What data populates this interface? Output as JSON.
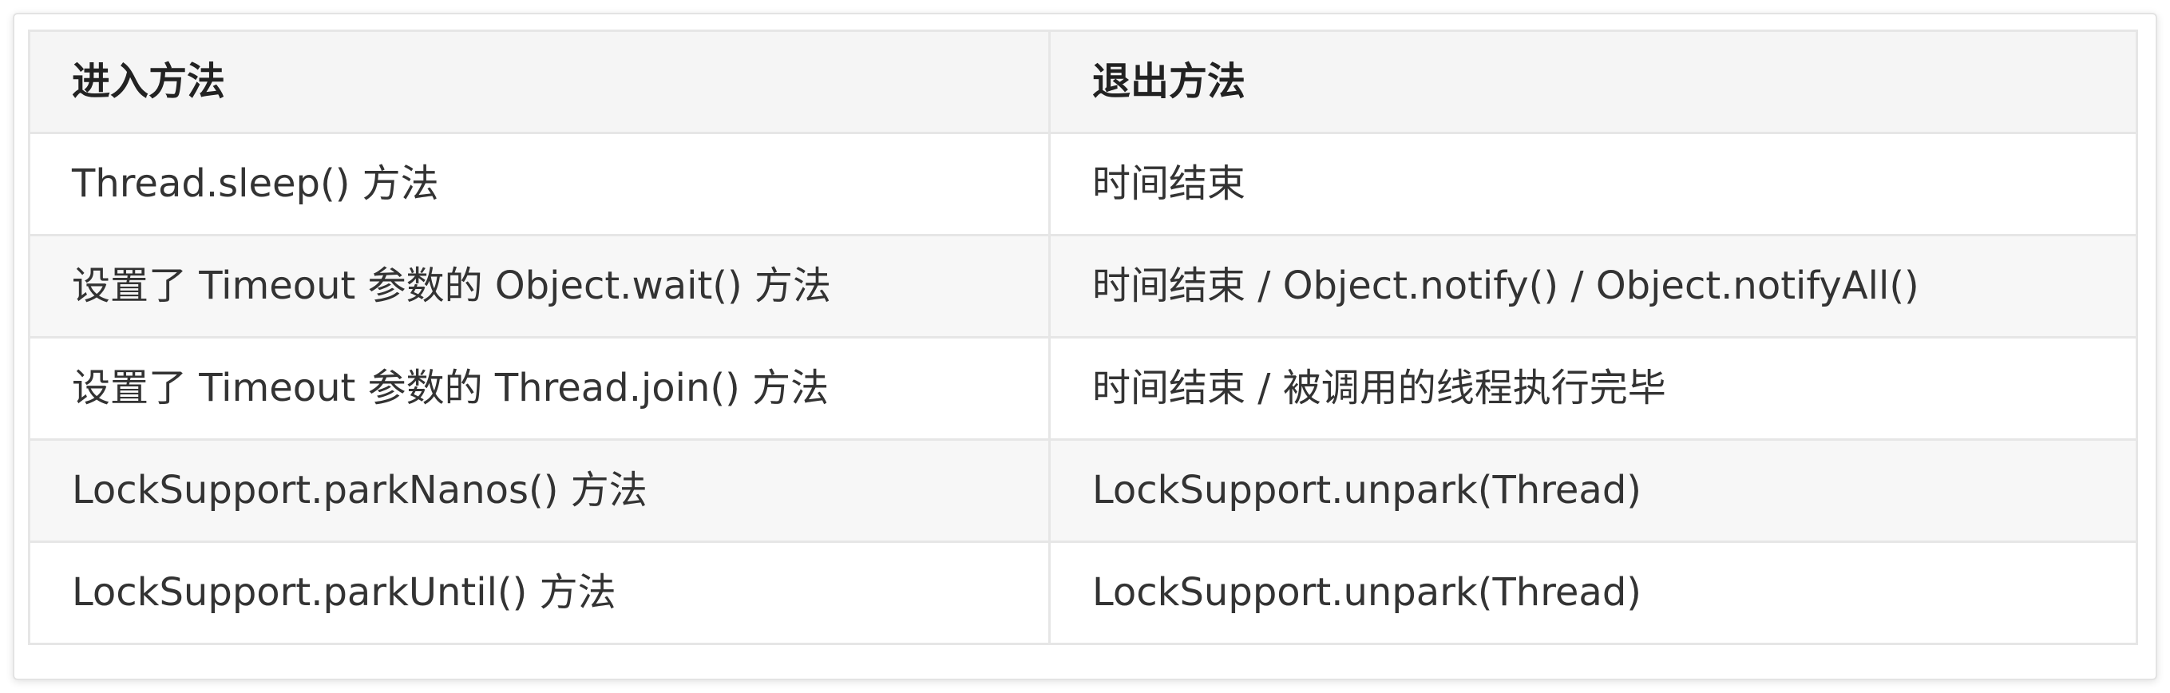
{
  "table": {
    "headers": [
      "进入方法",
      "退出方法"
    ],
    "rows": [
      [
        "Thread.sleep() 方法",
        "时间结束"
      ],
      [
        "设置了 Timeout 参数的 Object.wait() 方法",
        "时间结束 / Object.notify() / Object.notifyAll()"
      ],
      [
        "设置了 Timeout 参数的 Thread.join() 方法",
        "时间结束 / 被调用的线程执行完毕"
      ],
      [
        "LockSupport.parkNanos() 方法",
        "LockSupport.unpark(Thread)"
      ],
      [
        "LockSupport.parkUntil() 方法",
        "LockSupport.unpark(Thread)"
      ]
    ]
  },
  "colors": {
    "header_background": "#f5f5f5",
    "even_row_background": "#f7f7f7",
    "border": "#e6e6e6",
    "text": "#333333"
  }
}
